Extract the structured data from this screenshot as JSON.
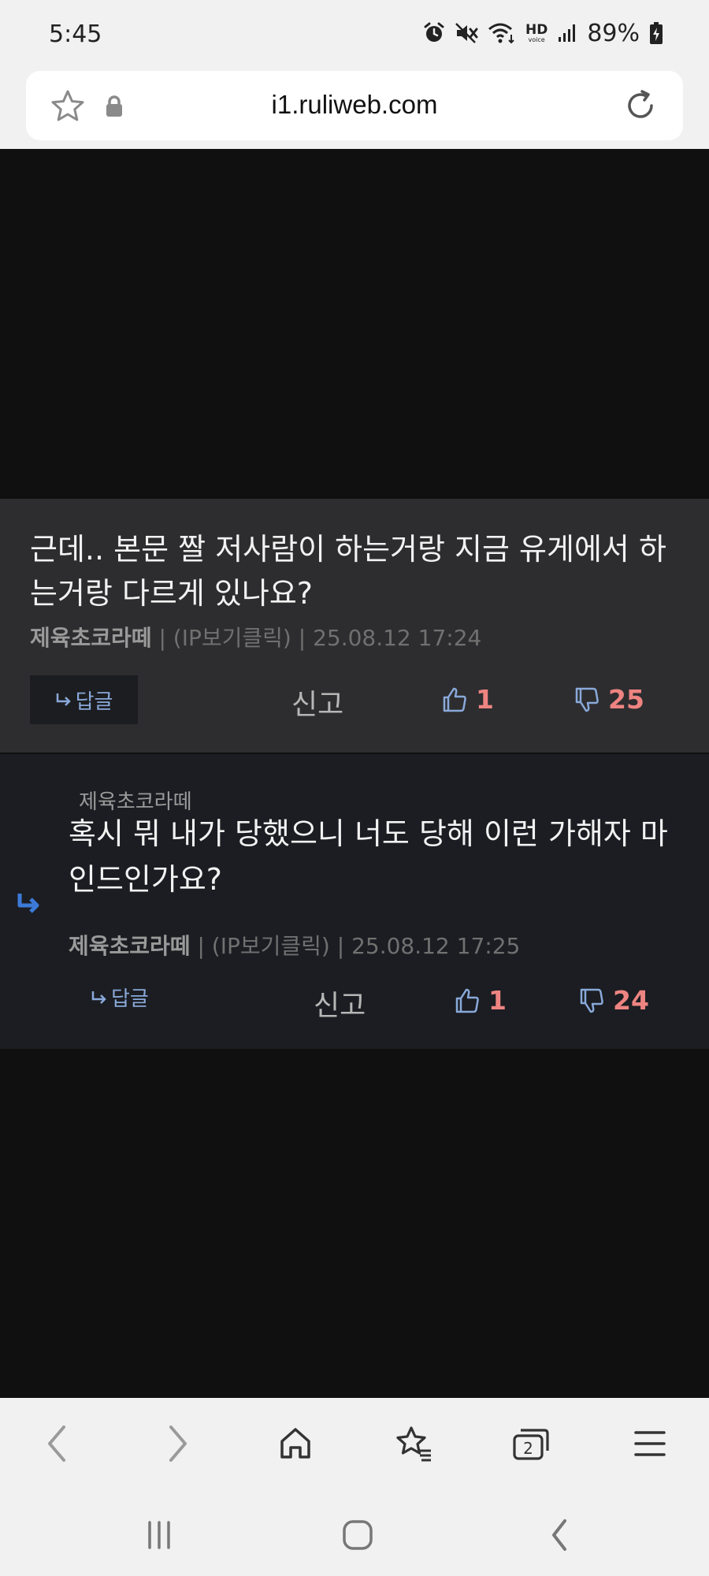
{
  "status_bar": {
    "time": "5:45",
    "hd_top": "HD",
    "hd_bottom": "voice",
    "battery": "89%",
    "icons": [
      "alarm-icon",
      "mute-icon",
      "wifi-icon",
      "hd-voice-icon",
      "signal-icon",
      "battery-charging-icon"
    ]
  },
  "address_bar": {
    "url": "i1.ruliweb.com",
    "icons": [
      "star-icon",
      "lock-icon",
      "reload-icon"
    ]
  },
  "comment": {
    "text": "근데.. 본문 짤 저사람이 하는거랑 지금 유게에서 하는거랑 다르게 있나요?",
    "author": "제육초코라떼",
    "ip_label": " | (IP보기클릭) | ",
    "datetime": "25.08.12 17:24",
    "reply_label": "답글",
    "report_label": "신고",
    "likes": "1",
    "dislikes": "25"
  },
  "reply": {
    "reply_to": "제육초코라떼",
    "text": "혹시 뭐 내가 당했으니 너도 당해 이런 가해자 마인드인가요?",
    "author": "제육초코라떼",
    "ip_label": " | (IP보기클릭) | ",
    "datetime": "25.08.12 17:25",
    "reply_label": "답글",
    "report_label": "신고",
    "likes": "1",
    "dislikes": "24"
  },
  "toolbar": {
    "tabs_count": "2",
    "icons": [
      "back-icon",
      "forward-icon",
      "home-icon",
      "bookmarks-icon",
      "tabs-icon",
      "menu-icon"
    ]
  },
  "nav_bar": {
    "icons": [
      "recents-icon",
      "home-icon",
      "back-icon"
    ]
  },
  "colors": {
    "background": "#101011",
    "comment_bg": "#2d2d2f",
    "reply_bg": "#1b1d22",
    "accent_blue": "#89a9da",
    "vote_red": "#ee8481"
  }
}
